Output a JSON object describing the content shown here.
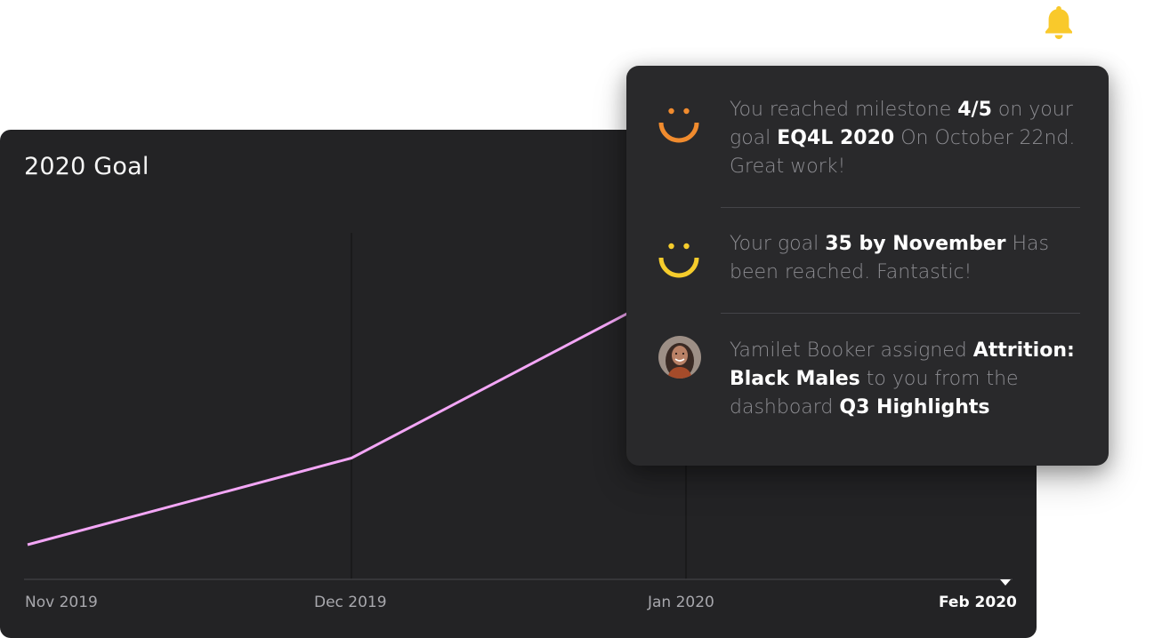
{
  "colors": {
    "bell": "#f9c92b",
    "line": "#f3a6f6",
    "smiley_orange": "#f08b2e",
    "smiley_yellow": "#f5cc2c",
    "card_bg": "#232325",
    "panel_bg": "#29292b"
  },
  "header": {
    "bell_icon": "bell-icon"
  },
  "chart": {
    "title": "2020 Goal",
    "x_labels": [
      "Nov 2019",
      "Dec 2019",
      "Jan 2020",
      "Feb 2020"
    ],
    "active_label": "Feb 2020"
  },
  "chart_data": {
    "type": "line",
    "title": "2020 Goal",
    "categories": [
      "Nov 2019",
      "Dec 2019",
      "Jan 2020",
      "Feb 2020"
    ],
    "x": [
      0,
      1,
      1.85
    ],
    "values": [
      10,
      35,
      78
    ],
    "ylim": [
      0,
      100
    ],
    "grid": "vertical",
    "xlabel": "",
    "ylabel": ""
  },
  "notifications": [
    {
      "icon": "smiley-orange-icon",
      "t1": "You reached milestone ",
      "b1": "4/5",
      "t2": " on your goal ",
      "b2": "EQ4L  2020",
      "t3": " On October 22nd. Great work!"
    },
    {
      "icon": "smiley-yellow-icon",
      "t1": "Your goal ",
      "b1": "35 by November",
      "t2": " Has been reached. Fantastic!"
    },
    {
      "icon": "avatar",
      "t1": "Yamilet Booker assigned ",
      "b1": "Attrition: Black Males",
      "t2": "  to you from the dashboard ",
      "b2": "Q3 Highlights"
    }
  ]
}
